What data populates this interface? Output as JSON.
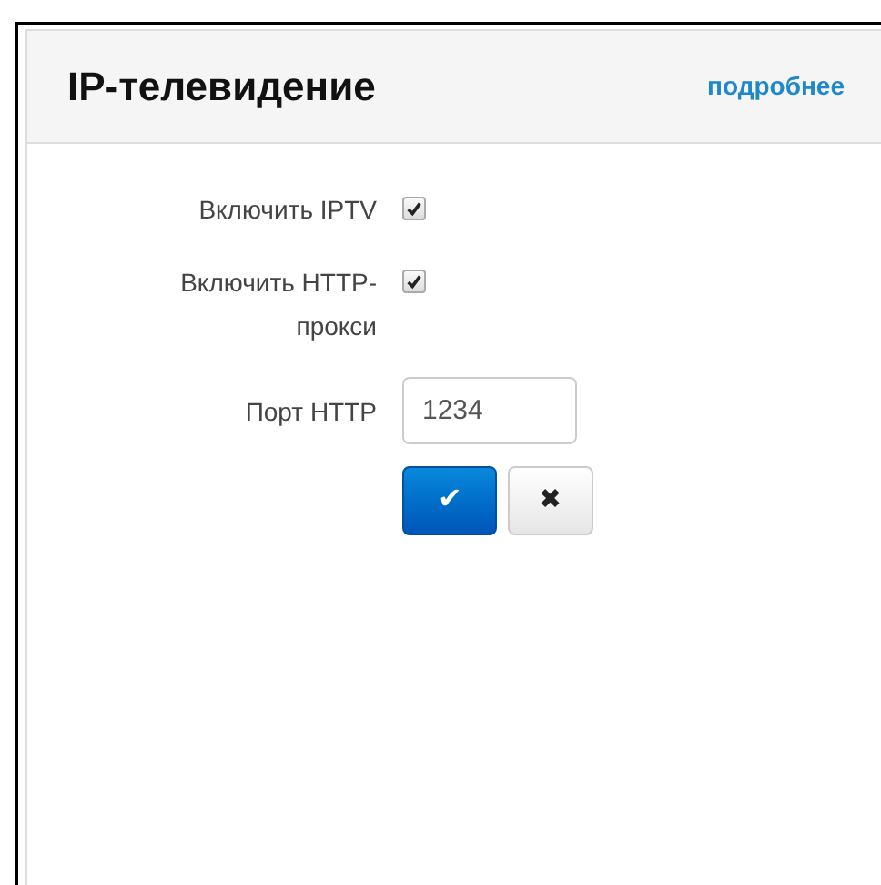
{
  "panel": {
    "title": "IP-телевидение",
    "link": "подробнее"
  },
  "fields": [
    {
      "kind": "checkbox",
      "label": "Включить IPTV",
      "checked": true
    },
    {
      "kind": "checkbox",
      "label": "Включить HTTP-прокси",
      "checked": true
    },
    {
      "kind": "text",
      "label": "Порт HTTP",
      "value": "1234"
    }
  ],
  "buttons": [
    {
      "kind": "save",
      "label": "✔"
    },
    {
      "kind": "cancel",
      "label": "✖"
    }
  ]
}
